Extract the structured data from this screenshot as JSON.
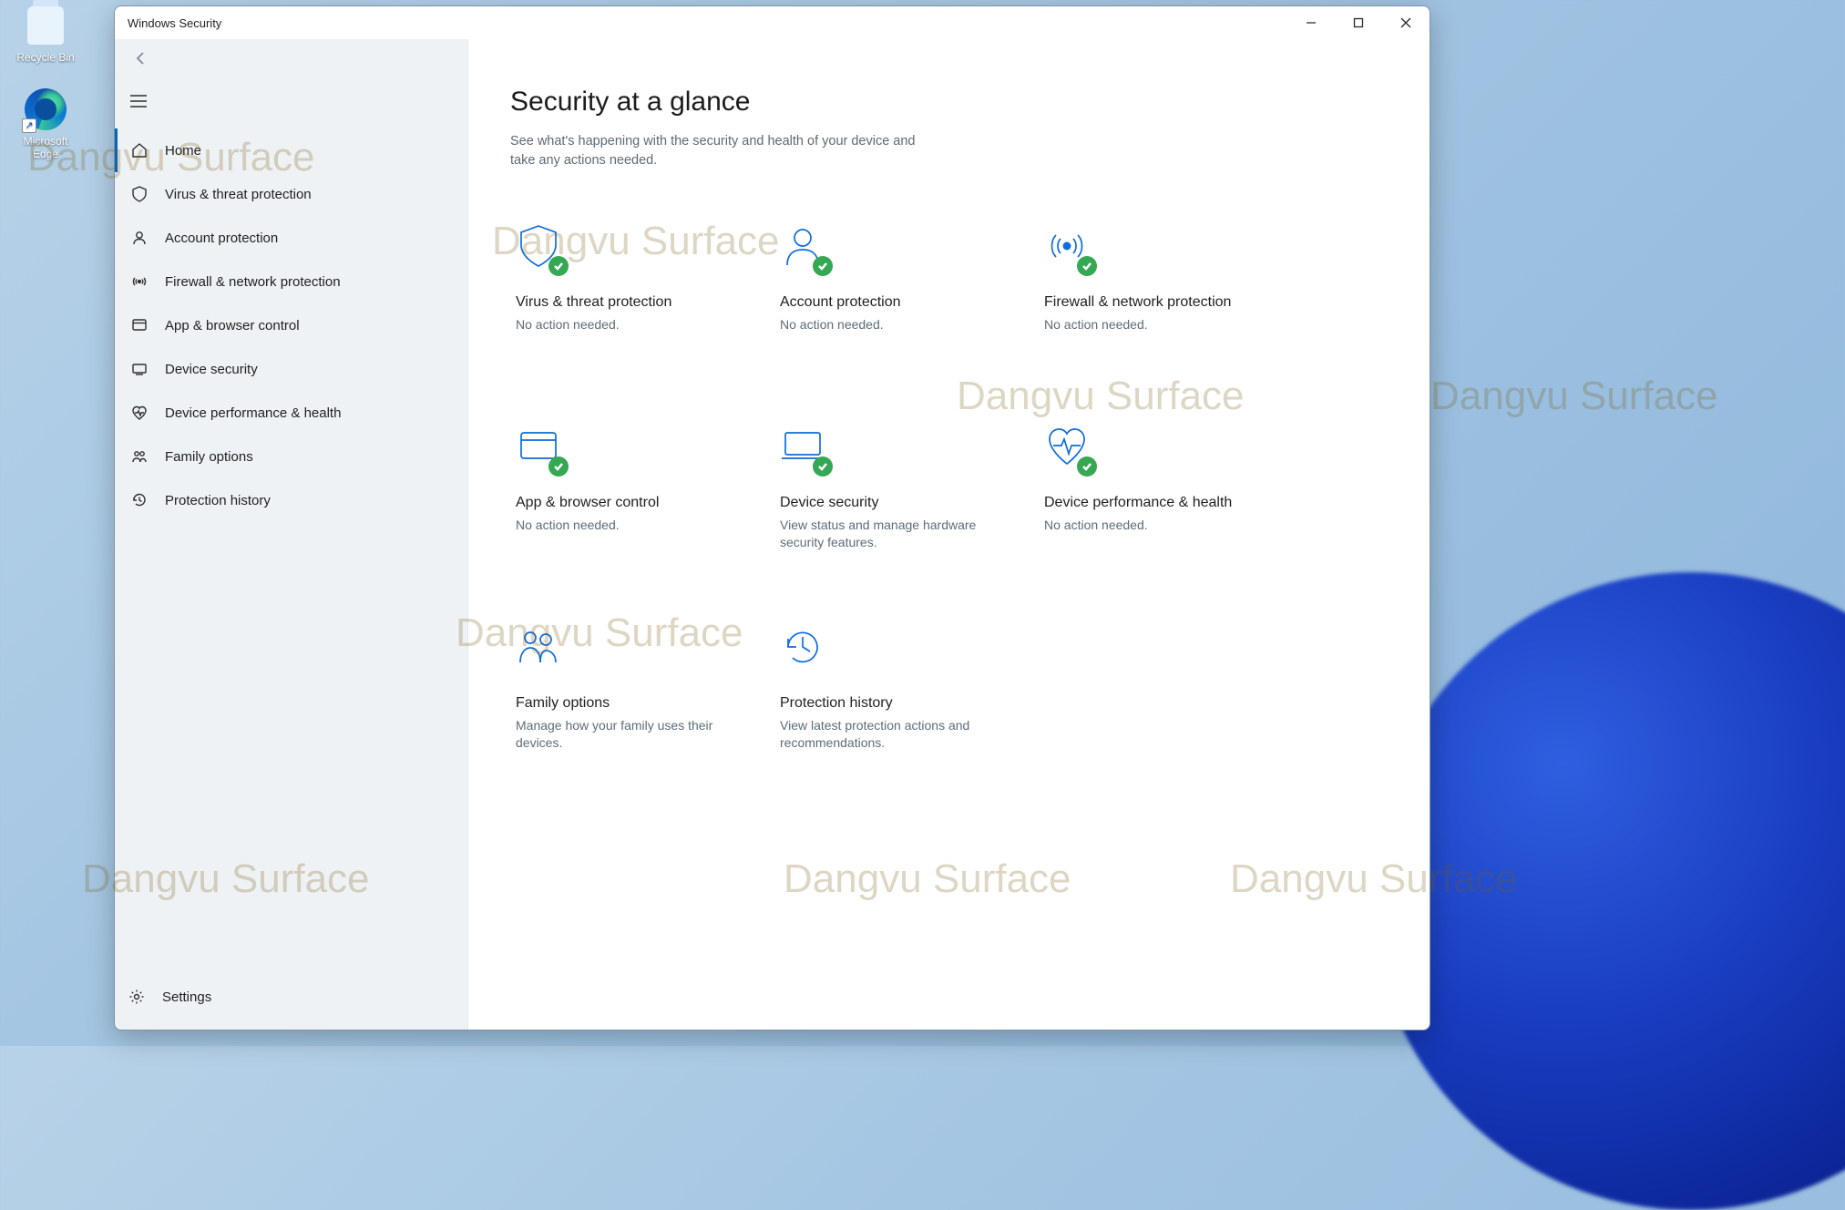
{
  "desktop": {
    "recycle_bin_label": "Recycle Bin",
    "edge_label": "Microsoft Edge"
  },
  "watermark_text": "Dangvu Surface",
  "window": {
    "title": "Windows Security"
  },
  "nav": {
    "items": [
      {
        "id": "home",
        "label": "Home",
        "active": true
      },
      {
        "id": "virus",
        "label": "Virus & threat protection",
        "active": false
      },
      {
        "id": "account",
        "label": "Account protection",
        "active": false
      },
      {
        "id": "firewall",
        "label": "Firewall & network protection",
        "active": false
      },
      {
        "id": "app",
        "label": "App & browser control",
        "active": false
      },
      {
        "id": "device-sec",
        "label": "Device security",
        "active": false
      },
      {
        "id": "perf",
        "label": "Device performance & health",
        "active": false
      },
      {
        "id": "family",
        "label": "Family options",
        "active": false
      },
      {
        "id": "history",
        "label": "Protection history",
        "active": false
      }
    ],
    "settings_label": "Settings"
  },
  "page": {
    "title": "Security at a glance",
    "subtitle": "See what's happening with the security and health of your device and take any actions needed."
  },
  "tiles": [
    {
      "id": "virus",
      "title": "Virus & threat protection",
      "sub": "No action needed.",
      "ok": true
    },
    {
      "id": "account",
      "title": "Account protection",
      "sub": "No action needed.",
      "ok": true
    },
    {
      "id": "firewall",
      "title": "Firewall & network protection",
      "sub": "No action needed.",
      "ok": true
    },
    {
      "id": "app",
      "title": "App & browser control",
      "sub": "No action needed.",
      "ok": true
    },
    {
      "id": "device",
      "title": "Device security",
      "sub": "View status and manage hardware security features.",
      "ok": true
    },
    {
      "id": "perf",
      "title": "Device performance & health",
      "sub": "No action needed.",
      "ok": true
    },
    {
      "id": "family",
      "title": "Family options",
      "sub": "Manage how your family uses their devices.",
      "ok": false
    },
    {
      "id": "history",
      "title": "Protection history",
      "sub": "View latest protection actions and recommendations.",
      "ok": false
    }
  ]
}
